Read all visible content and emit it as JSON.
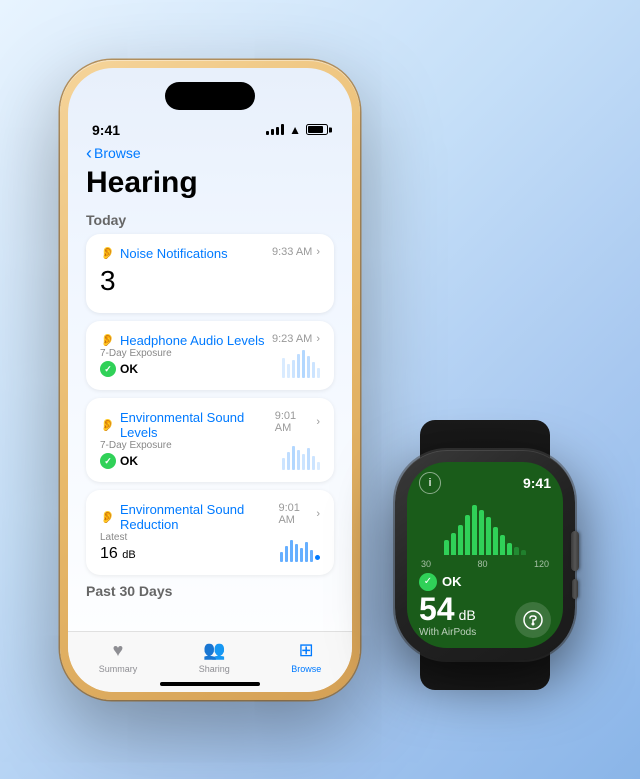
{
  "background": {
    "gradient_start": "#e8f4ff",
    "gradient_end": "#8ab5e8"
  },
  "iphone": {
    "status_bar": {
      "time": "9:41",
      "signal": "●●●●",
      "wifi": "wifi",
      "battery": "battery"
    },
    "nav": {
      "back_label": "Browse"
    },
    "title": "Hearing",
    "section_today": "Today",
    "section_past": "Past 30 Days",
    "cards": [
      {
        "id": "noise-notifications",
        "title": "Noise Notifications",
        "time": "9:33 AM",
        "value": "3",
        "type": "count"
      },
      {
        "id": "headphone-audio-levels",
        "title": "Headphone Audio Levels",
        "time": "9:23 AM",
        "sub_label": "7-Day Exposure",
        "status": "OK",
        "type": "exposure"
      },
      {
        "id": "environmental-sound-levels",
        "title": "Environmental Sound Levels",
        "time": "9:01 AM",
        "sub_label": "7-Day Exposure",
        "status": "OK",
        "type": "exposure"
      },
      {
        "id": "environmental-sound-reduction",
        "title": "Environmental Sound Reduction",
        "time": "9:01 AM",
        "sub_label": "Latest",
        "value": "16",
        "unit": "dB",
        "type": "level"
      }
    ],
    "tabs": [
      {
        "id": "summary",
        "label": "Summary",
        "icon": "♥",
        "active": false
      },
      {
        "id": "sharing",
        "label": "Sharing",
        "icon": "👥",
        "active": false
      },
      {
        "id": "browse",
        "label": "Browse",
        "icon": "⊞",
        "active": true
      }
    ]
  },
  "watch": {
    "time": "9:41",
    "info_icon": "i",
    "scale": [
      "30",
      "80",
      "120"
    ],
    "status": "OK",
    "db_value": "54",
    "db_unit": "dB",
    "with_label": "With AirPods"
  }
}
